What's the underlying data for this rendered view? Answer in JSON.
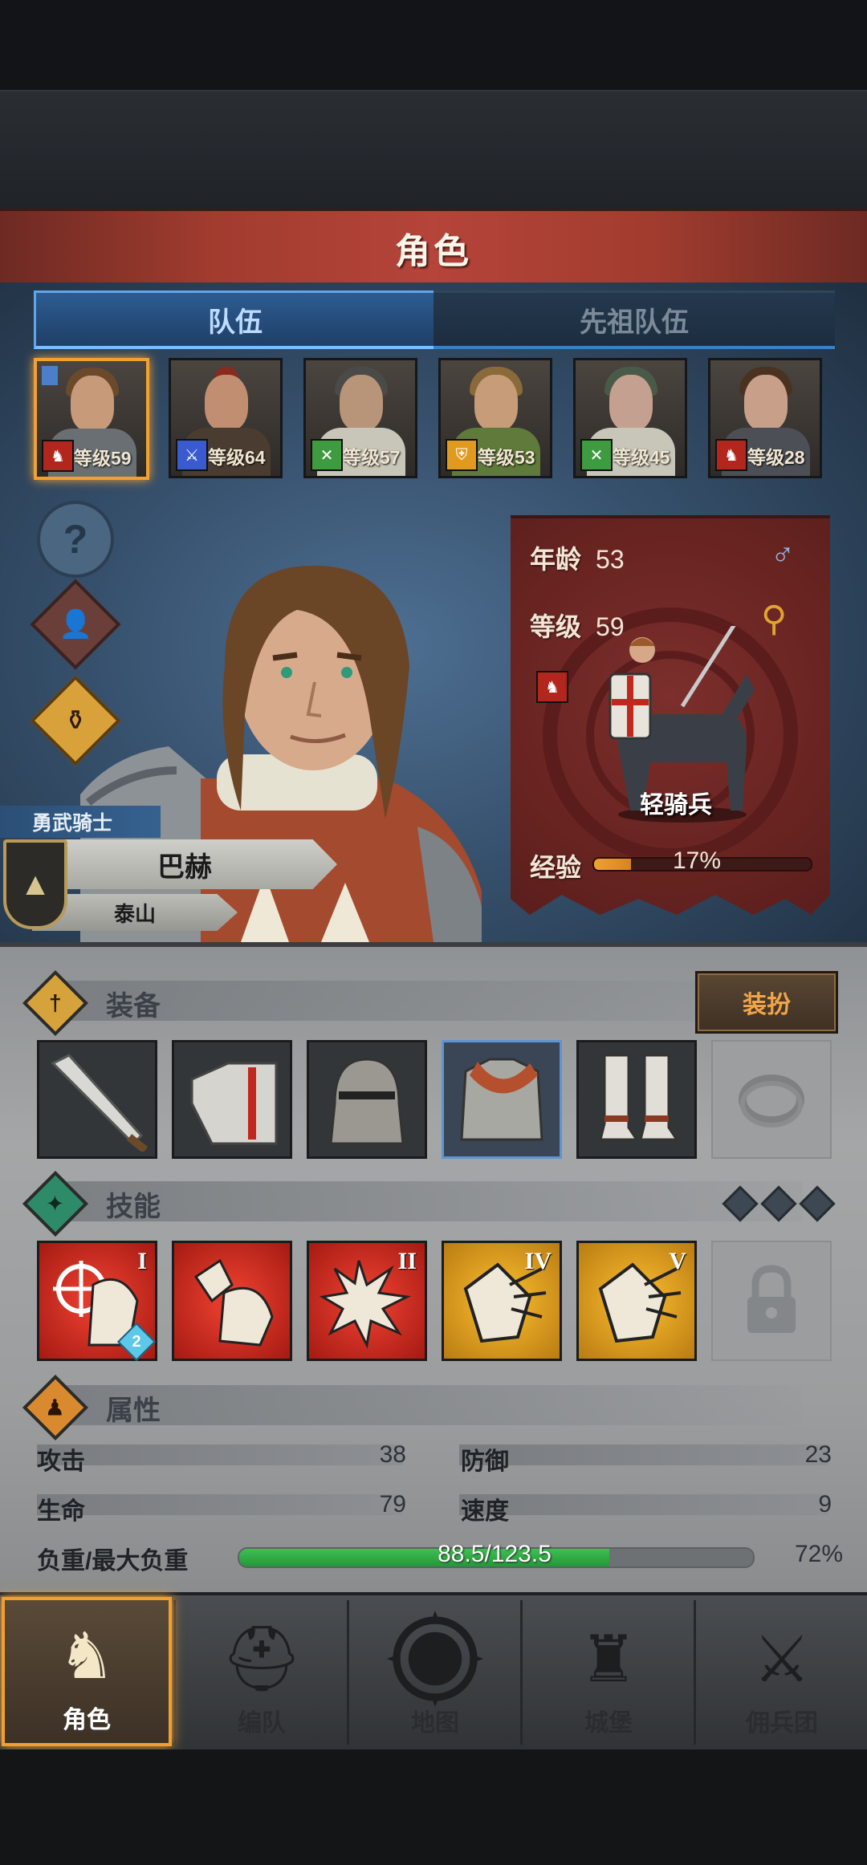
{
  "screen": {
    "title": "角色"
  },
  "tabs": [
    {
      "label": "队伍",
      "active": true
    },
    {
      "label": "先祖队伍",
      "active": false
    }
  ],
  "roster": [
    {
      "level_text": "等级59",
      "class_icon": "horse-icon",
      "class_color": "#b3261e",
      "selected": true
    },
    {
      "level_text": "等级64",
      "class_icon": "sword-icon",
      "class_color": "#3a5bd0",
      "selected": false
    },
    {
      "level_text": "等级57",
      "class_icon": "crossbow-icon",
      "class_color": "#3f9b3f",
      "selected": false
    },
    {
      "level_text": "等级53",
      "class_icon": "shield-icon",
      "class_color": "#e09a1f",
      "selected": false
    },
    {
      "level_text": "等级45",
      "class_icon": "crossbow-icon",
      "class_color": "#3f9b3f",
      "selected": false
    },
    {
      "level_text": "等级28",
      "class_icon": "horse-icon",
      "class_color": "#b3261e",
      "selected": false
    }
  ],
  "hero": {
    "title": "勇武骑士",
    "name": "巴赫",
    "origin": "泰山",
    "age_label": "年龄",
    "age": "53",
    "level_label": "等级",
    "level": "59",
    "gender_icon": "male-icon",
    "class_name": "轻骑兵",
    "exp_label": "经验",
    "exp_percent_text": "17%",
    "exp_fraction": 0.17
  },
  "equipment": {
    "title": "装备",
    "dress_label": "装扮",
    "slots": [
      "sword-icon",
      "shoulder-armor-icon",
      "helmet-icon",
      "chainmail-icon",
      "boots-icon",
      "ring-slot-icon"
    ]
  },
  "skills": {
    "title": "技能",
    "items": [
      {
        "icon": "target-horse-icon",
        "numeral": "I",
        "color": "red",
        "level": "2"
      },
      {
        "icon": "horse-charge-icon",
        "numeral": "",
        "color": "red",
        "level": ""
      },
      {
        "icon": "burst-icon",
        "numeral": "II",
        "color": "red",
        "level": ""
      },
      {
        "icon": "shield-break-icon",
        "numeral": "IV",
        "color": "gold",
        "level": ""
      },
      {
        "icon": "shield-break-icon",
        "numeral": "V",
        "color": "gold",
        "level": ""
      },
      {
        "icon": "lock-icon",
        "numeral": "",
        "color": "locked",
        "level": ""
      }
    ]
  },
  "attributes": {
    "title": "属性",
    "attack_label": "攻击",
    "attack": "38",
    "defense_label": "防御",
    "defense": "23",
    "health_label": "生命",
    "health": "79",
    "speed_label": "速度",
    "speed": "9",
    "load_label": "负重/最大负重",
    "load_text": "88.5/123.5",
    "load_fraction": 0.72,
    "load_percent_text": "72%"
  },
  "nav": [
    {
      "label": "角色",
      "icon": "knight-icon",
      "active": true
    },
    {
      "label": "编队",
      "icon": "helmet-icon",
      "active": false
    },
    {
      "label": "地图",
      "icon": "compass-map-icon",
      "active": false
    },
    {
      "label": "城堡",
      "icon": "castle-icon",
      "active": false
    },
    {
      "label": "佣兵团",
      "icon": "mercenary-icon",
      "active": false
    }
  ],
  "colors": {
    "title_bar": "#a23c2f",
    "tab_active": "#62a6ea",
    "highlight": "#f1a032",
    "banner": "#6a2522",
    "load_bar": "#23983a"
  }
}
